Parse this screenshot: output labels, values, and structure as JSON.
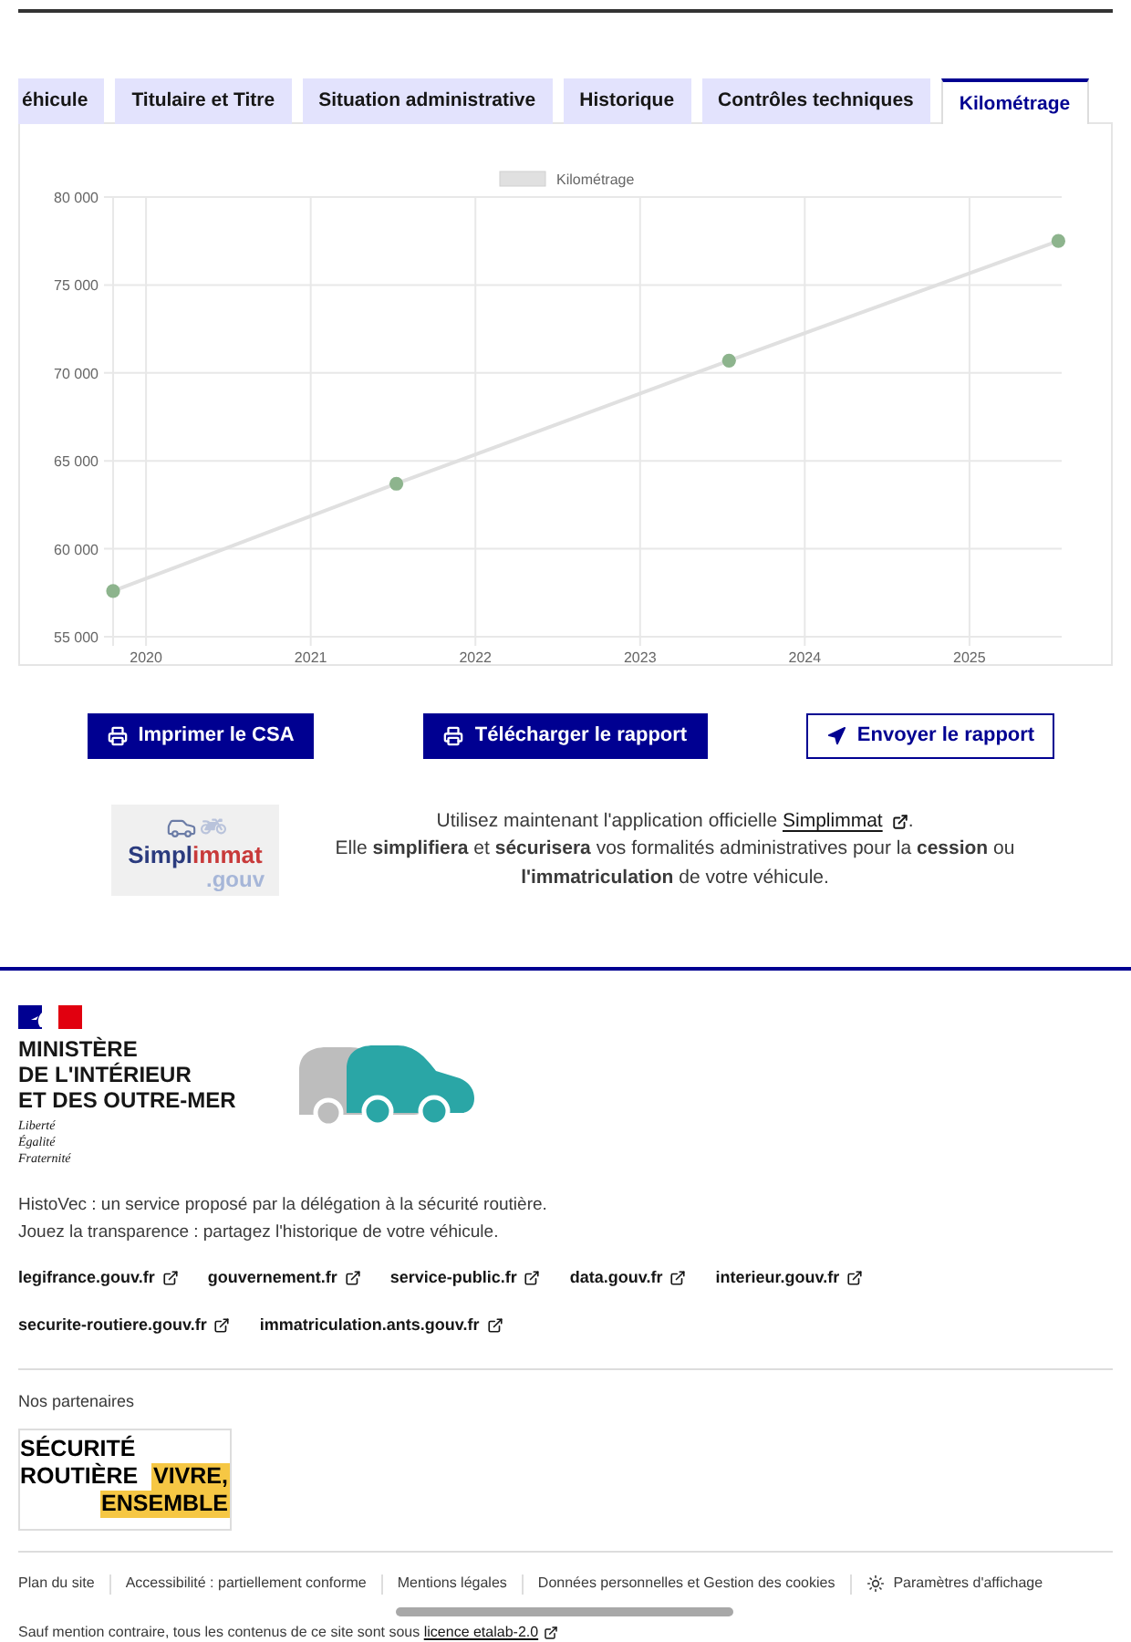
{
  "tabs": [
    {
      "label": "éhicule",
      "selected": false
    },
    {
      "label": "Titulaire et Titre",
      "selected": false
    },
    {
      "label": "Situation administrative",
      "selected": false
    },
    {
      "label": "Historique",
      "selected": false
    },
    {
      "label": "Contrôles techniques",
      "selected": false
    },
    {
      "label": "Kilométrage",
      "selected": true
    }
  ],
  "chart": {
    "chart_data": {
      "type": "line",
      "grid": true,
      "x": [
        2019.8,
        2021.52,
        2023.54,
        2025.54
      ],
      "series": [
        {
          "name": "Kilométrage",
          "color": "#e0e0e0",
          "marker": true,
          "values": [
            57600,
            63700,
            70700,
            77500
          ]
        }
      ],
      "xlim": [
        2019.8,
        2025.56
      ],
      "ylim": [
        55000,
        80000
      ],
      "xticks": [
        2020,
        2021,
        2022,
        2023,
        2024,
        2025
      ],
      "yticks": [
        {
          "value": 55000,
          "label": "55 000"
        },
        {
          "value": 60000,
          "label": "60 000"
        },
        {
          "value": 65000,
          "label": "65 000"
        },
        {
          "value": 70000,
          "label": "70 000"
        },
        {
          "value": 75000,
          "label": "75 000"
        },
        {
          "value": 80000,
          "label": "80 000"
        }
      ]
    }
  },
  "actions": [
    {
      "kind": "print",
      "label": "Imprimer le CSA"
    },
    {
      "kind": "print",
      "label": "Télécharger le rapport"
    },
    {
      "kind": "send",
      "label": "Envoyer le rapport"
    }
  ],
  "simplimmat": {
    "logo": {
      "word_start": "Simpl",
      "word_end": "immat",
      "domain": ".gouv"
    },
    "intro_before": "Utilisez maintenant l'application officielle",
    "link": "Simplimmat",
    "intro_after": ".",
    "details": "Elle **simplifiera** et **sécurisera** vos formalités administratives pour la **cession** ou **l'immatriculation** de votre véhicule."
  },
  "footer": {
    "ministry": {
      "name_lines": [
        "MINISTÈRE",
        "DE L'INTÉRIEUR",
        "ET DES OUTRE-MER"
      ],
      "motto_lines": [
        "Liberté",
        "Égalité",
        "Fraternité"
      ]
    },
    "description": [
      "HistoVec : un service proposé par la délégation à la sécurité routière.",
      "Jouez la transparence : partagez l'historique de votre véhicule."
    ],
    "link_rows": [
      [
        "legifrance.gouv.fr",
        "gouvernement.fr",
        "service-public.fr",
        "data.gouv.fr",
        "interieur.gouv.fr"
      ],
      [
        "securite-routiere.gouv.fr",
        "immatriculation.ants.gouv.fr"
      ]
    ],
    "partners_title": "Nos partenaires",
    "partner_logo": {
      "plain": [
        "SÉCURITÉ",
        "ROUTIÈRE"
      ],
      "highlighted": [
        "VIVRE,",
        "ENSEMBLE"
      ]
    },
    "bottom_links": [
      {
        "kind": "link",
        "label": "Plan du site"
      },
      {
        "kind": "link",
        "label": "Accessibilité : partiellement conforme"
      },
      {
        "kind": "link",
        "label": "Mentions légales"
      },
      {
        "kind": "link",
        "label": "Données personnelles et Gestion des cookies"
      },
      {
        "kind": "display_settings",
        "label": "Paramètres d'affichage"
      }
    ],
    "license": {
      "text": "Sauf mention contraire, tous les contenus de ce site sont sous",
      "link": "licence etalab-2.0"
    }
  }
}
